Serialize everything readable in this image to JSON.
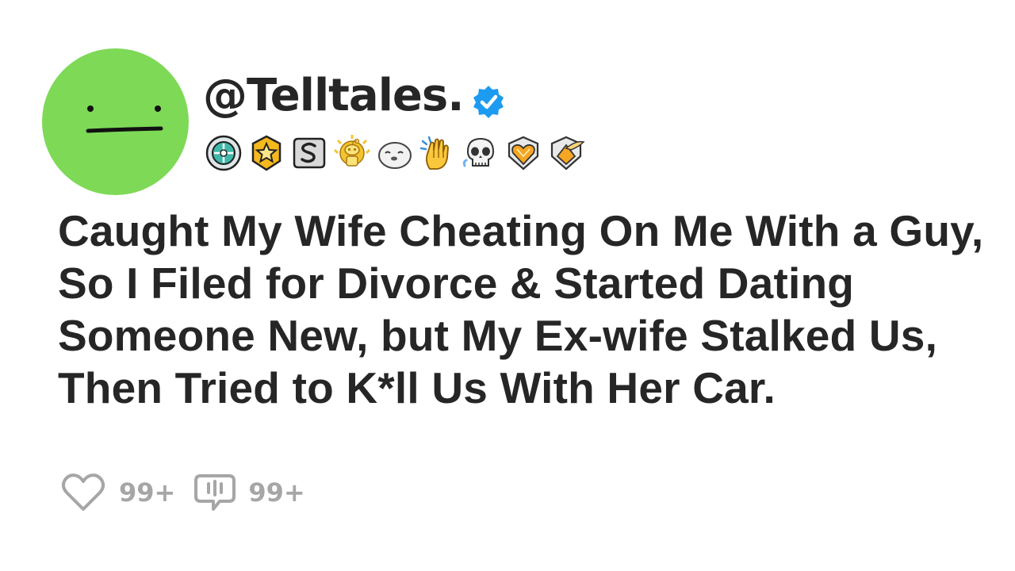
{
  "post": {
    "handle": "@Telltales.",
    "verified": true,
    "avatar_color": "#7ed957",
    "badges": [
      {
        "icon": "compass-badge-icon"
      },
      {
        "icon": "star-badge-icon"
      },
      {
        "icon": "s-badge-icon"
      },
      {
        "icon": "gold-snoo-award-icon"
      },
      {
        "icon": "seal-badge-icon"
      },
      {
        "icon": "clapping-hands-icon"
      },
      {
        "icon": "skull-icon"
      },
      {
        "icon": "heart-gem-badge-icon"
      },
      {
        "icon": "winged-gem-badge-icon"
      }
    ],
    "title": "Caught My Wife Cheating On Me With a Guy, So I Filed for Divorce & Started Dating Someone New, but My Ex-wife Stalked Us, Then Tried to K*ll Us With Her Car.",
    "stats": {
      "likes": "99+",
      "comments": "99+"
    },
    "colors": {
      "text": "#262626",
      "muted": "#a6a6a6",
      "verified": "#1d9bf0"
    }
  }
}
